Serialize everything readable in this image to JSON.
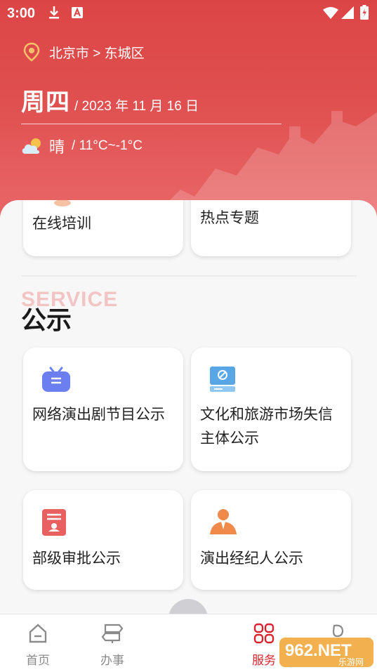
{
  "status_bar": {
    "time": "3:00"
  },
  "header": {
    "location": "北京市 > 东城区",
    "weekday": "周四",
    "date": "/ 2023 年 11 月 16 日",
    "weather_condition": "晴",
    "temperature": "/ 11°C~-1°C"
  },
  "top_cards": [
    {
      "label": "在线培训"
    },
    {
      "label": "热点专题"
    }
  ],
  "section": {
    "bg_text": "SERVICE",
    "title": "公示"
  },
  "notice_cards": [
    {
      "label": "网络演出剧节目公示",
      "icon": "tv-icon"
    },
    {
      "label": "文化和旅游市场失信主体公示",
      "icon": "monitor-icon"
    },
    {
      "label": "部级审批公示",
      "icon": "certificate-icon"
    },
    {
      "label": "演出经纪人公示",
      "icon": "agent-icon"
    }
  ],
  "tabs": [
    {
      "label": "首页",
      "icon": "home-icon",
      "active": false
    },
    {
      "label": "办事",
      "icon": "signpost-icon",
      "active": false
    },
    {
      "label": "服务",
      "icon": "grid-icon",
      "active": true
    },
    {
      "label": "",
      "icon": "profile-icon",
      "active": false
    }
  ],
  "watermark": {
    "text": "962.NET",
    "sub": "乐游网"
  },
  "colors": {
    "brand_red": "#dc4545",
    "active_tab": "#d8242e"
  }
}
